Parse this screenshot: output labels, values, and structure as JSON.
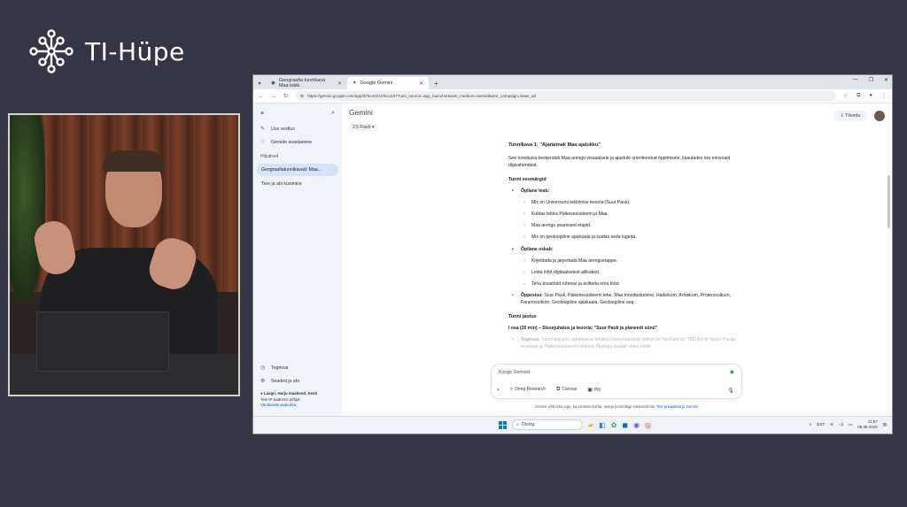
{
  "logo": {
    "text": "TI-Hüpe",
    "color": "#ffffff"
  },
  "browser": {
    "tabs": [
      {
        "label": "Geograafia tunnikava Maa tekki",
        "active": false
      },
      {
        "label": "Google Gemini",
        "active": true
      }
    ],
    "url": "https://gemini.google.com/app/875c43212fea1197?utm_source=app_launcher&utm_medium=owned&utm_campaign=base_all"
  },
  "gemini": {
    "title": "Gemini",
    "model": "2.5 Flash",
    "share_label": "Tõenda",
    "sidebar": {
      "new_chat": "Uus vestlus",
      "explore_gems": "Gemide avastamine",
      "recent_header": "Hiljutised",
      "recent_items": [
        "Geograafiatunnikavad: Maa...",
        "Tere ja abi küsimine"
      ],
      "activity": "Tegevus",
      "settings": "Seaded ja abi",
      "location_line1": "Laagri, Harju maakond, Eesti",
      "location_line2": "Teie IP-aadressi põhjal",
      "location_link": "Värskenda asukohta"
    },
    "content": {
      "heading": "Tunnikava 1: \"Ajarännak Maa ajalukku\"",
      "intro": "See tunnikava keskendub Maa arengu visuaalsele ja ajastule orienteeritud õppimisele, kasutades ära erinevaid digivahendeid.",
      "goals_heading": "Tunni eesmärgid",
      "student_knows_label": "Õpilane teab:",
      "student_knows": [
        "Mis on Universumi tekkimise teooria (Suur Pauk).",
        "Kuidas tekkis Päikesesüsteem ja Maa.",
        "Maa arengu peamised etapid.",
        "Mis on geoloogiline ajaskaala ja kuidas seda lugeda."
      ],
      "student_can_label": "Õpilane oskab:",
      "student_can": [
        "Kirjeldada ja järjestada Maa arenguetappe.",
        "Leida infot digitaalsetest allikatest.",
        "Teha koostööd rühmas ja esitleda oma tööd."
      ],
      "terms_label": "Õppesisu:",
      "terms_text": " Suur Pauk, Päikesesüsteemi teke, Maa moodustumine, Hadeikum, Arhaikum, Proterosoikum, Fanerosoikum, Geoloogiline ajaskaala, Geoloogiline aeg.",
      "structure_heading": "Tunni jaotus",
      "part1_heading": "I osa (20 min) – Sissejuhatus ja teooria: \"Suur Pauk ja planeedi sünd\"",
      "activity_label": "Tegevus:",
      "activity_text": " Tunni alguses vaadatakse lühikest keeruhaaravat videot (nt YouTube'ist, TED-Ed'ist Suure Paugu teooriast ja Päikesesüsteemi tekkest. Õpetaja peatab video kriitili"
    },
    "input": {
      "placeholder": "Küsige Geminilt",
      "tools": [
        "Deep Research",
        "Canvas",
        "Pilt"
      ],
      "disclaimer": "Gemini võib teha vigu, ka inimeste kohta, seega kontrollige vastuseid üle.",
      "disclaimer_link": "Teie privaatsus ja Gemini"
    }
  },
  "taskbar": {
    "search_placeholder": "Otsing",
    "lang": "EST",
    "time": "11:57",
    "date": "05.06.2025"
  }
}
